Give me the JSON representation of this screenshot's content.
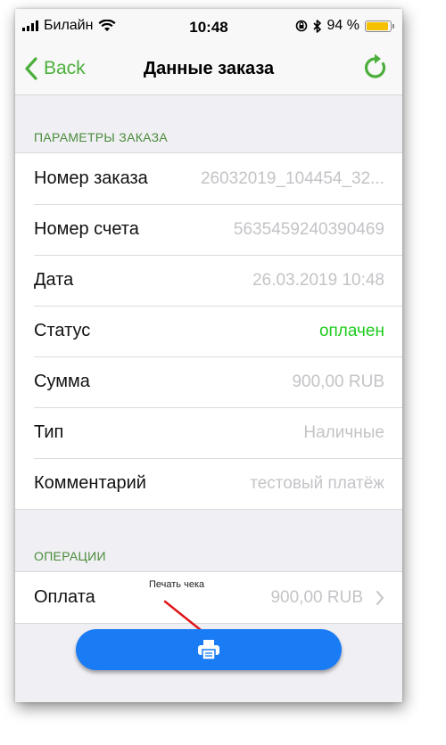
{
  "status_bar": {
    "carrier": "Билайн",
    "time": "10:48",
    "battery_percent": "94 %",
    "battery_level": 0.94
  },
  "nav": {
    "back_label": "Back",
    "title": "Данные заказа"
  },
  "order_section": {
    "header": "ПАРАМЕТРЫ ЗАКАЗА",
    "rows": [
      {
        "label": "Номер заказа",
        "value": "26032019_104454_32..."
      },
      {
        "label": "Номер счета",
        "value": "5635459240390469"
      },
      {
        "label": "Дата",
        "value": "26.03.2019 10:48"
      },
      {
        "label": "Статус",
        "value": "оплачен"
      },
      {
        "label": "Сумма",
        "value": "900,00 RUB"
      },
      {
        "label": "Тип",
        "value": "Наличные"
      },
      {
        "label": "Комментарий",
        "value": "тестовый платёж"
      }
    ]
  },
  "operations_section": {
    "header": "ОПЕРАЦИИ",
    "rows": [
      {
        "label": "Оплата",
        "value": "900,00 RUB"
      }
    ]
  },
  "annotation": {
    "tooltip": "Печать чека"
  },
  "colors": {
    "accent_green": "#4caf3c",
    "status_paid": "#1ecc1e",
    "print_button": "#1a7cf5",
    "annotation_arrow": "#e0161a"
  },
  "icons": {
    "print_button": "printer-icon",
    "refresh": "refresh-icon",
    "back": "chevron-left-icon"
  }
}
